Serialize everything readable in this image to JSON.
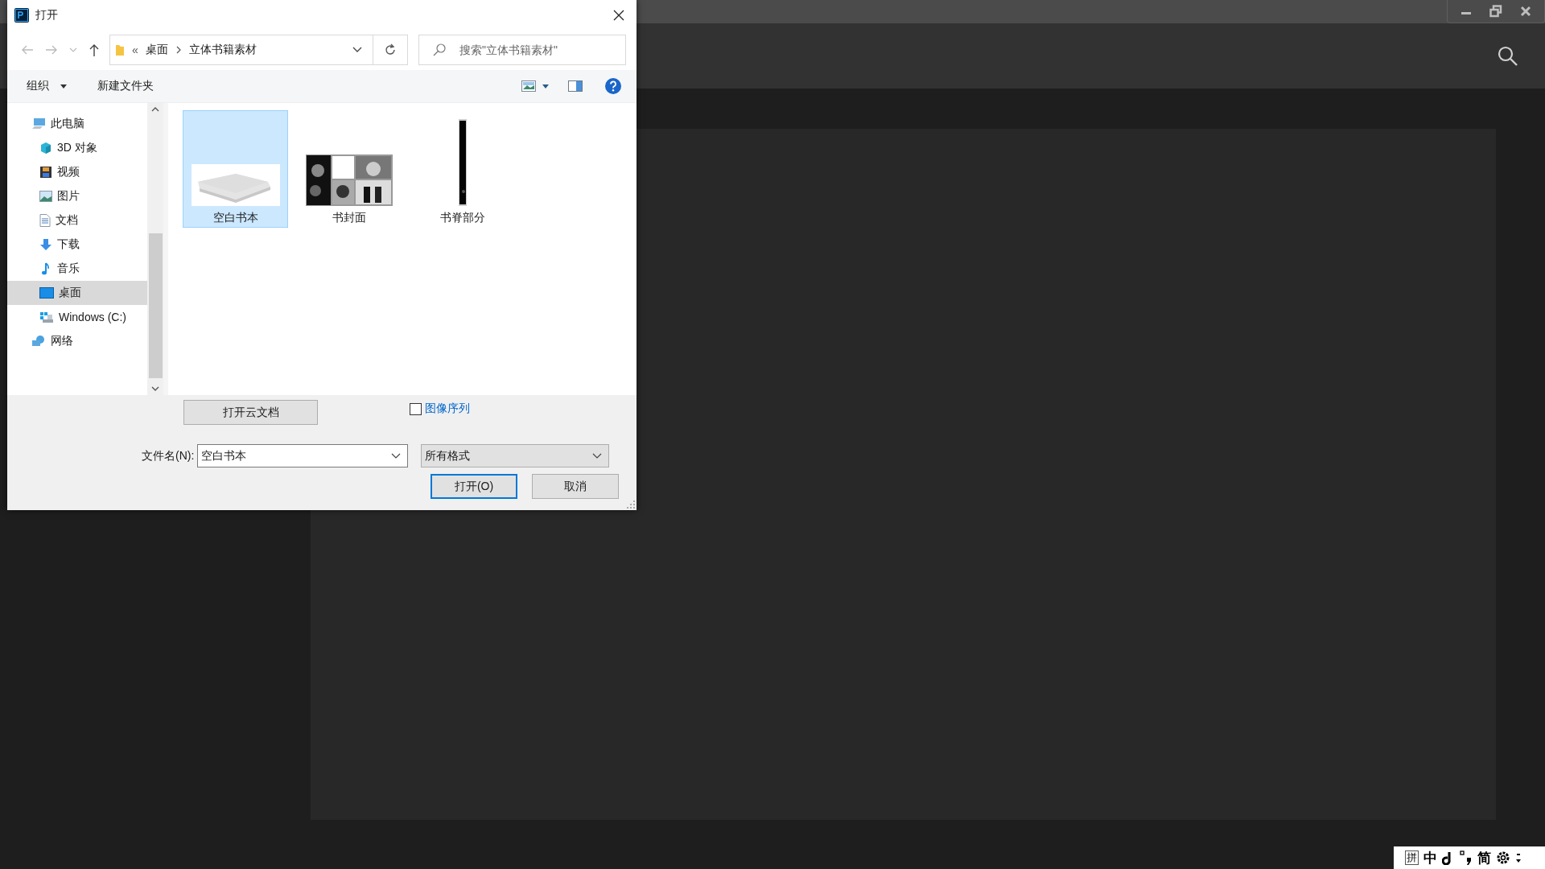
{
  "dialog": {
    "title": "打开",
    "address": {
      "overflow": "«",
      "items": [
        "桌面",
        "立体书籍素材"
      ]
    },
    "search": {
      "placeholder": "搜索\"立体书籍素材\""
    },
    "toolbar": {
      "organize": "组织",
      "new_folder": "新建文件夹"
    },
    "sidebar": {
      "items": [
        {
          "label": "此电脑",
          "kind": "pc",
          "selected": false,
          "children": [
            {
              "label": "3D 对象",
              "kind": "cube",
              "selected": false
            },
            {
              "label": "视频",
              "kind": "video",
              "selected": false
            },
            {
              "label": "图片",
              "kind": "picture",
              "selected": false
            },
            {
              "label": "文档",
              "kind": "document",
              "selected": false
            },
            {
              "label": "下载",
              "kind": "download",
              "selected": false
            },
            {
              "label": "音乐",
              "kind": "music",
              "selected": false
            },
            {
              "label": "桌面",
              "kind": "desktop",
              "selected": true
            },
            {
              "label": "Windows (C:)",
              "kind": "drive",
              "selected": false
            }
          ]
        },
        {
          "label": "网络",
          "kind": "network",
          "selected": false
        }
      ]
    },
    "files": [
      {
        "name": "空白书本",
        "selected": true
      },
      {
        "name": "书封面",
        "selected": false
      },
      {
        "name": "书脊部分",
        "selected": false
      }
    ],
    "cloud_button": "打开云文档",
    "image_sequence": {
      "label": "图像序列",
      "checked": false
    },
    "filename": {
      "label": "文件名(N):",
      "value": "空白书本"
    },
    "filetype": {
      "value": "所有格式"
    },
    "buttons": [
      {
        "label": "打开(O)",
        "default": true
      },
      {
        "label": "取消",
        "default": false
      }
    ]
  },
  "ime_bar": {
    "items": [
      {
        "kind": "boxed",
        "text": "拼"
      },
      {
        "kind": "text",
        "text": "中"
      },
      {
        "kind": "moon"
      },
      {
        "kind": "punct"
      },
      {
        "kind": "text",
        "text": "简"
      },
      {
        "kind": "gear"
      },
      {
        "kind": "more"
      }
    ]
  }
}
